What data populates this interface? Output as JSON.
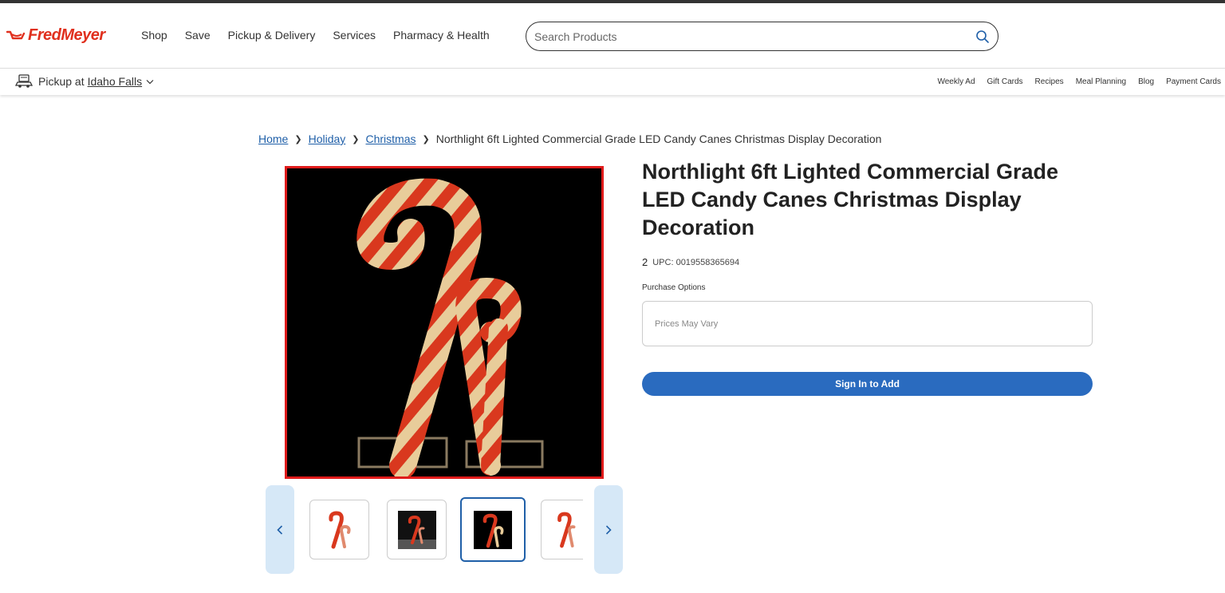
{
  "brand": {
    "name": "FredMeyer",
    "color": "#e0301e"
  },
  "nav": {
    "items": [
      {
        "label": "Shop"
      },
      {
        "label": "Save"
      },
      {
        "label": "Pickup & Delivery"
      },
      {
        "label": "Services"
      },
      {
        "label": "Pharmacy & Health"
      }
    ]
  },
  "search": {
    "placeholder": "Search Products",
    "icon": "search-icon"
  },
  "pickup": {
    "prefix": "Pickup at",
    "store": "Idaho Falls",
    "icon": "pickup-car-icon"
  },
  "sublinks": [
    {
      "label": "Weekly Ad"
    },
    {
      "label": "Gift Cards"
    },
    {
      "label": "Recipes"
    },
    {
      "label": "Meal Planning"
    },
    {
      "label": "Blog"
    },
    {
      "label": "Payment Cards"
    }
  ],
  "breadcrumb": {
    "items": [
      {
        "label": "Home"
      },
      {
        "label": "Holiday"
      },
      {
        "label": "Christmas"
      }
    ],
    "current": "Northlight 6ft Lighted Commercial Grade LED Candy Canes Christmas Display Decoration"
  },
  "product": {
    "title": "Northlight 6ft Lighted Commercial Grade LED Candy Canes Christmas Display Decoration",
    "count": "2",
    "upc": "UPC: 0019558365694",
    "purchase_options_label": "Purchase Options",
    "price_note": "Prices May Vary",
    "cta": "Sign In to Add"
  },
  "gallery": {
    "prev_icon": "chevron-left-icon",
    "next_icon": "chevron-right-icon",
    "active_index": 2,
    "accent": "#1f5fa8",
    "selected_border": "#e01b1b"
  }
}
